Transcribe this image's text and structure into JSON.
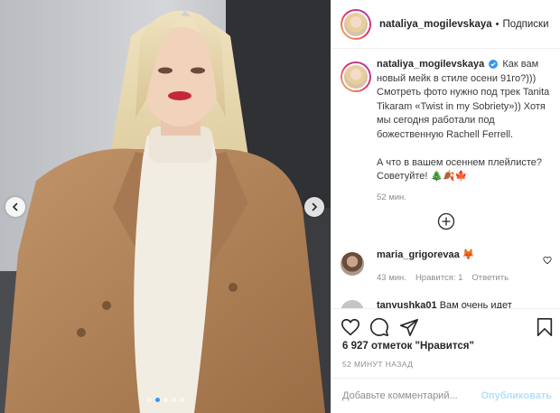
{
  "header": {
    "username": "nataliya_mogilevskaya",
    "separator": "•",
    "follow_label": "Подписки"
  },
  "caption": {
    "username": "nataliya_mogilevskaya",
    "text_1": "Как вам новый мейк в стиле осени 91го?))) Смотреть фото нужно под трек Tanita Tikaram «Twist in my Sobriety»)) Хотя мы сегодня работали под божественную Rachell Ferrell.",
    "text_2": "А что в вашем осеннем плейлисте? Советуйте!",
    "emojis": "🎄🍂🍁",
    "time": "52 мин."
  },
  "comments": [
    {
      "username": "maria_grigorevaa",
      "emoji": "🦊",
      "time": "43 мин.",
      "likes": "Нравится: 1",
      "reply": "Ответить"
    },
    {
      "username": "tanyushka01",
      "text": "Вам очень идет"
    }
  ],
  "stats": {
    "likes": "6 927 отметок \"Нравится\"",
    "time_ago": "52 МИНУТ НАЗАД"
  },
  "comment_box": {
    "placeholder": "Добавьте комментарий...",
    "post_label": "Опубликовать"
  },
  "carousel": {
    "slides": 5,
    "active": 1
  },
  "icons": [
    "chevron-left-icon",
    "chevron-right-icon",
    "verified-icon",
    "add-more-icon",
    "heart-icon",
    "comment-icon",
    "share-icon",
    "bookmark-icon"
  ],
  "colors": {
    "accent": "#3897f0",
    "text": "#262626",
    "muted": "#8e8e8e",
    "post_disabled": "#b2dffc",
    "coat": "#b08256"
  }
}
